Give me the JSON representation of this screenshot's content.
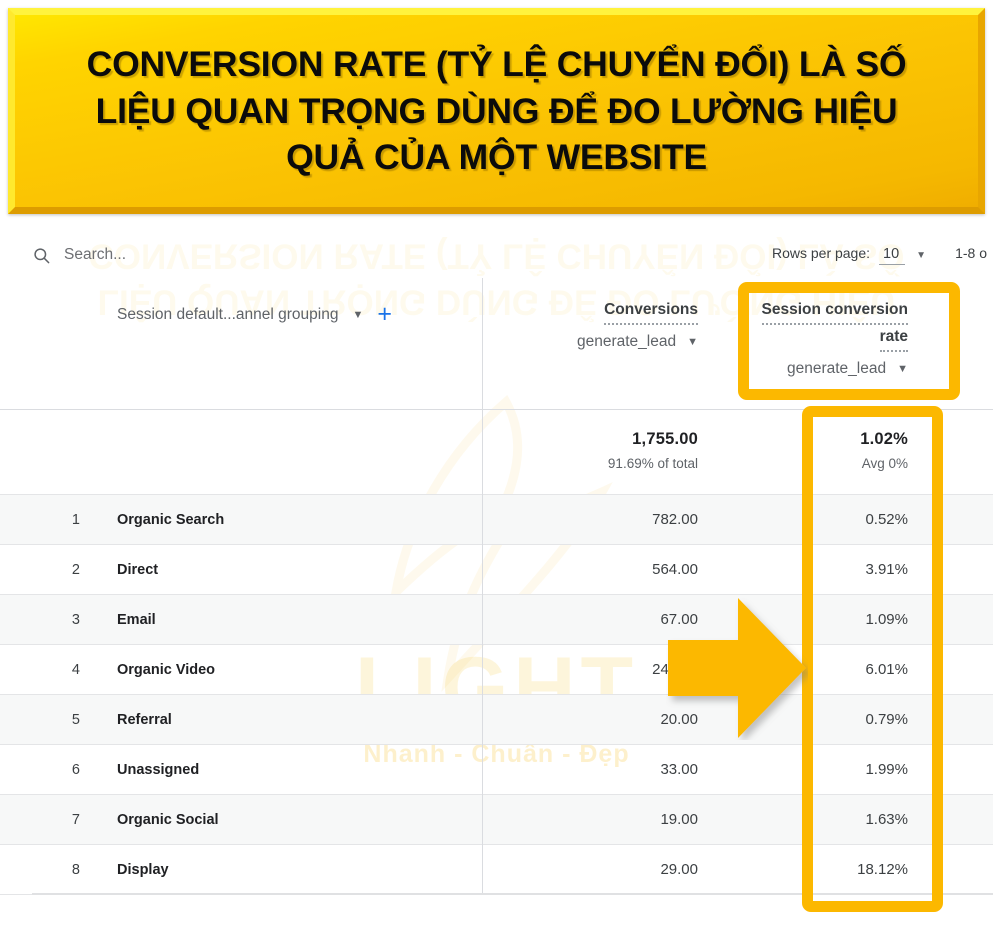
{
  "banner": {
    "lines": [
      "CONVERSION RATE (TỶ LỆ CHUYỂN ĐỔI) LÀ SỐ",
      "LIỆU QUAN TRỌNG DÙNG ĐỂ ĐO LƯỜNG HIỆU",
      "QUẢ CỦA MỘT WEBSITE"
    ],
    "background_color": "#fbc403",
    "text_color": "#0b0b0b"
  },
  "watermark": {
    "brand": "LIGHT",
    "tagline": "Nhanh - Chuẩn - Đẹp",
    "color": "#f7ce56"
  },
  "toolbar": {
    "search_icon": "search-icon",
    "search_placeholder": "Search...",
    "rows_per_page_label": "Rows per page:",
    "rows_per_page_value": "10",
    "rows_caret": "▼",
    "range_text": "1-8 o"
  },
  "table": {
    "dimension_header": {
      "label": "Session default...annel grouping",
      "caret": "▼",
      "add_icon": "+"
    },
    "metrics": [
      {
        "title": "Conversions",
        "event": "generate_lead",
        "caret": "▼",
        "total": "1,755.00",
        "total_sub": "91.69% of total"
      },
      {
        "title": "Session conversion rate",
        "title_line1": "Session conversion",
        "title_line2": "rate",
        "event": "generate_lead",
        "caret": "▼",
        "total": "1.02%",
        "total_sub": "Avg 0%"
      }
    ],
    "rows": [
      {
        "index": "1",
        "name": "Organic Search",
        "conversions": "782.00",
        "rate": "0.52%"
      },
      {
        "index": "2",
        "name": "Direct",
        "conversions": "564.00",
        "rate": "3.91%"
      },
      {
        "index": "3",
        "name": "Email",
        "conversions": "67.00",
        "rate": "1.09%"
      },
      {
        "index": "4",
        "name": "Organic Video",
        "conversions": "241.00",
        "rate": "6.01%"
      },
      {
        "index": "5",
        "name": "Referral",
        "conversions": "20.00",
        "rate": "0.79%"
      },
      {
        "index": "6",
        "name": "Unassigned",
        "conversions": "33.00",
        "rate": "1.99%"
      },
      {
        "index": "7",
        "name": "Organic Social",
        "conversions": "19.00",
        "rate": "1.63%"
      },
      {
        "index": "8",
        "name": "Display",
        "conversions": "29.00",
        "rate": "18.12%"
      }
    ]
  },
  "annotations": {
    "highlight_color": "#fcb800",
    "arrow_color": "#fcb800",
    "arrow_direction": "right",
    "highlight_targets": [
      "session-conversion-rate-header",
      "session-conversion-rate-column"
    ]
  }
}
